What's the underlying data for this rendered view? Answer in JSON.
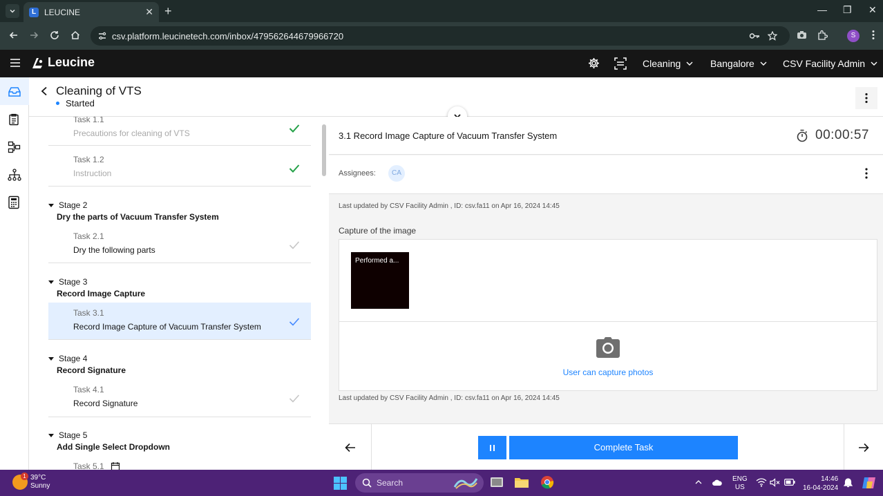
{
  "browser": {
    "tab_title": "LEUCINE",
    "tab_favicon": "L",
    "url": "csv.platform.leucinetech.com/inbox/479562644679966720",
    "profile_initial": "S"
  },
  "app": {
    "logo_text": "Leucine",
    "use_case": "Cleaning",
    "facility": "Bangalore",
    "user": "CSV Facility Admin"
  },
  "job": {
    "title": "Cleaning of VTS",
    "state": "Started"
  },
  "tasks": {
    "task_1_1": {
      "number": "Task 1.1",
      "name": "Precautions for cleaning of VTS"
    },
    "task_1_2": {
      "number": "Task 1.2",
      "name": "Instruction"
    },
    "stage_2": {
      "number": "Stage 2",
      "name": "Dry the parts of Vacuum Transfer System"
    },
    "task_2_1": {
      "number": "Task 2.1",
      "name": "Dry the following parts"
    },
    "stage_3": {
      "number": "Stage 3",
      "name": "Record Image Capture"
    },
    "task_3_1": {
      "number": "Task 3.1",
      "name": "Record Image Capture of Vacuum Transfer System"
    },
    "stage_4": {
      "number": "Stage 4",
      "name": "Record Signature"
    },
    "task_4_1": {
      "number": "Task 4.1",
      "name": "Record Signature"
    },
    "stage_5": {
      "number": "Stage 5",
      "name": "Add Single Select Dropdown"
    },
    "task_5_1": {
      "number": "Task 5.1"
    }
  },
  "detail": {
    "task_title": "3.1 Record Image Capture of Vacuum Transfer System",
    "timer": "00:00:57",
    "assignees_label": "Assignees:",
    "assignee_initials": "CA",
    "last_updated_top": "Last updated by CSV Facility Admin , ID: csv.fa11 on Apr 16, 2024 14:45",
    "capture_label": "Capture of the image",
    "thumbnail_caption": "Performed a...",
    "capture_link": "User can capture photos",
    "last_updated_bottom": "Last updated by CSV Facility Admin , ID: csv.fa11 on Apr 16, 2024 14:45",
    "complete_button": "Complete Task"
  },
  "taskbar": {
    "temperature": "39°C",
    "weather": "Sunny",
    "weather_badge": "1",
    "search_label": "Search",
    "lang_top": "ENG",
    "lang_bottom": "US",
    "time": "14:46",
    "date": "16-04-2024"
  },
  "colors": {
    "accent": "#1d84ff",
    "header_bg": "#161616",
    "taskbar_bg": "#4d2276",
    "check_green": "#24a148"
  }
}
